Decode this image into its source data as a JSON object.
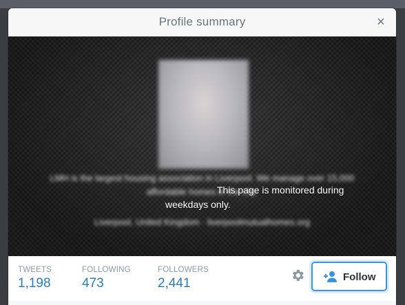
{
  "modal": {
    "title": "Profile summary",
    "close_label": "×"
  },
  "profile": {
    "bio_blurred": "LMH is the largest housing association in Liverpool. We manage over 15,000 affordable homes in the city.",
    "bio_visible_line1": "This page is monitored during",
    "bio_visible_line2": "weekdays only.",
    "location_blurred": "Liverpool, United Kingdom · liverpoolmutualhomes.org"
  },
  "stats": {
    "tweets": {
      "label": "TWEETS",
      "value": "1,198"
    },
    "following": {
      "label": "FOLLOWING",
      "value": "473"
    },
    "followers": {
      "label": "FOLLOWERS",
      "value": "2,441"
    }
  },
  "actions": {
    "follow_label": "Follow",
    "gear_icon": "gear-icon",
    "follow_icon": "add-user-icon"
  },
  "colors": {
    "accent": "#2b7bb9",
    "follow_border": "#3b94d9",
    "label_gray": "#8899a6",
    "title_gray": "#66757f"
  }
}
